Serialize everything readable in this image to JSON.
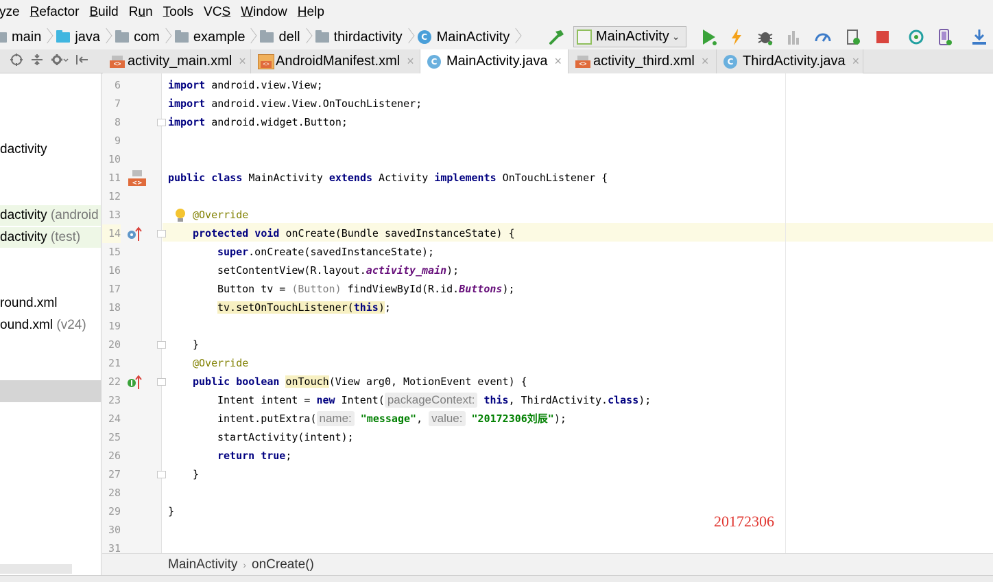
{
  "menu": [
    "yze",
    "Refactor",
    "Build",
    "Run",
    "Tools",
    "VCS",
    "Window",
    "Help"
  ],
  "menu_mnemonic_index": [
    -1,
    0,
    0,
    1,
    0,
    2,
    0,
    0
  ],
  "breadcrumbs": [
    "main",
    "java",
    "com",
    "example",
    "dell",
    "thirdactivity",
    "MainActivity"
  ],
  "run_config": "MainActivity",
  "tabs": [
    {
      "label": "activity_main.xml",
      "icon": "xml-file-icon"
    },
    {
      "label": "AndroidManifest.xml",
      "icon": "manifest-file-icon"
    },
    {
      "label": "MainActivity.java",
      "icon": "class-icon",
      "active": true
    },
    {
      "label": "activity_third.xml",
      "icon": "xml-file-icon"
    },
    {
      "label": "ThirdActivity.java",
      "icon": "class-icon"
    }
  ],
  "project_tree": {
    "row1": "dactivity",
    "row2": {
      "name": "dactivity",
      "hint": "(android"
    },
    "row3": {
      "name": "dactivity",
      "hint": "(test)"
    },
    "row4": "round.xml",
    "row5": {
      "name": "ound.xml",
      "hint": "(v24)"
    }
  },
  "line_numbers": [
    "6",
    "7",
    "8",
    "9",
    "10",
    "11",
    "12",
    "13",
    "14",
    "15",
    "16",
    "17",
    "18",
    "19",
    "20",
    "21",
    "22",
    "23",
    "24",
    "25",
    "26",
    "27",
    "28",
    "29",
    "30",
    "31"
  ],
  "code": {
    "l6": {
      "kw": "import",
      "rest": " android.view.View;"
    },
    "l7": {
      "kw": "import",
      "rest": " android.view.View.OnTouchListener;"
    },
    "l8": {
      "kw": "import",
      "rest": " android.widget.Button;"
    },
    "l11": {
      "kw1": "public class",
      "t1": " MainActivity ",
      "kw2": "extends",
      "t2": " Activity ",
      "kw3": "implements",
      "t3": " OnTouchListener {"
    },
    "l13": {
      "ann": "@Override"
    },
    "l14": {
      "kw": "protected void",
      "rest": " onCreate(Bundle savedInstanceState) {"
    },
    "l15": {
      "kw": "super",
      "rest": ".onCreate(savedInstanceState);"
    },
    "l16": {
      "t1": "setContentView(R.layout.",
      "fld": "activity_main",
      "t2": ");"
    },
    "l17": {
      "t1": "Button tv = ",
      "cast": "(Button)",
      "t2": " findViewById(R.id.",
      "fld": "Buttons",
      "t3": ");"
    },
    "l18": {
      "t1": "tv.setOnTouchListener(",
      "kw": "this",
      "t2": ")",
      "t3": ";"
    },
    "l20": {
      "t": "}"
    },
    "l21": {
      "ann": "@Override"
    },
    "l22": {
      "kw": "public boolean",
      "t1": " ",
      "method": "onTouch",
      "t2": "(View arg0, MotionEvent event) {"
    },
    "l23": {
      "t1": "Intent intent = ",
      "kw1": "new",
      "t2": " Intent(",
      "hint": "packageContext:",
      "kw2": "this",
      "t3": ", ThirdActivity.",
      "kw3": "class",
      "t4": ");"
    },
    "l24": {
      "t1": "intent.putExtra(",
      "hint1": "name:",
      "s1": "\"message\"",
      "t2": ", ",
      "hint2": "value:",
      "s2": "\"20172306刘辰\"",
      "t3": ");"
    },
    "l25": {
      "t": "startActivity(intent);"
    },
    "l26": {
      "kw1": "return",
      "t1": " ",
      "kw2": "true",
      "t2": ";"
    },
    "l27": {
      "t": "}"
    },
    "l29": {
      "t": "}"
    }
  },
  "watermark": "20172306",
  "editor_breadcrumb": [
    "MainActivity",
    "onCreate()"
  ]
}
